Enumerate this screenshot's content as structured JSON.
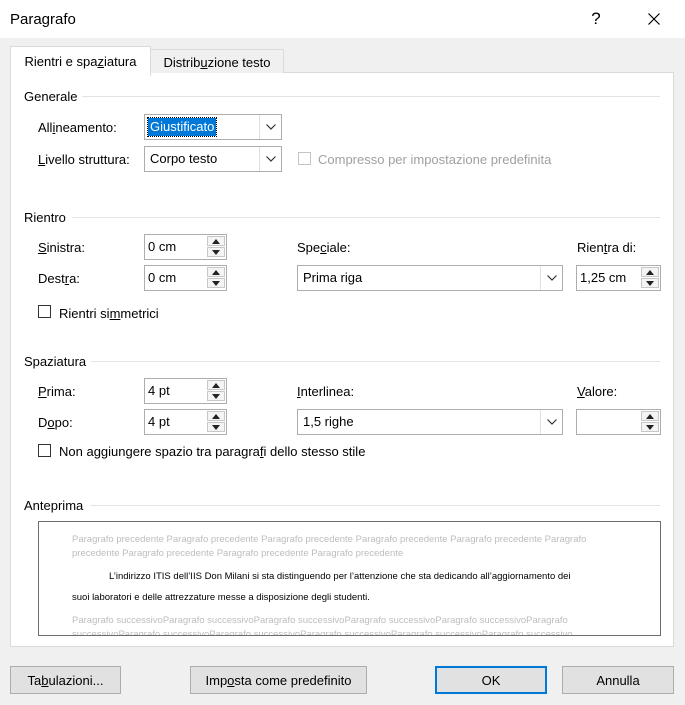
{
  "window": {
    "title": "Paragrafo",
    "help_label": "?",
    "close_label": "✕"
  },
  "tabs": [
    {
      "label": "Rientri e spaziatura",
      "active": true
    },
    {
      "label": "Distribuzione testo",
      "active": false
    }
  ],
  "general": {
    "title": "Generale",
    "alignment_label": "Allineamento:",
    "alignment_value": "Giustificato",
    "outline_label": "Livello struttura:",
    "outline_value": "Corpo testo",
    "collapsed_label": "Compresso per impostazione predefinita",
    "collapsed_checked": false
  },
  "indent": {
    "title": "Rientro",
    "left_label": "Sinistra:",
    "left_value": "0 cm",
    "right_label": "Destra:",
    "right_value": "0 cm",
    "special_label": "Speciale:",
    "special_value": "Prima riga",
    "by_label": "Rientra di:",
    "by_value": "1,25 cm",
    "mirror_label": "Rientri simmetrici",
    "mirror_checked": false
  },
  "spacing": {
    "title": "Spaziatura",
    "before_label": "Prima:",
    "before_value": "4 pt",
    "after_label": "Dopo:",
    "after_value": "4 pt",
    "line_label": "Interlinea:",
    "line_value": "1,5 righe",
    "at_label": "Valore:",
    "at_value": "",
    "no_space_label": "Non aggiungere spazio tra paragrafi dello stesso stile",
    "no_space_checked": false
  },
  "preview": {
    "title": "Anteprima",
    "prev_line1": "Paragrafo precedente Paragrafo precedente Paragrafo precedente Paragrafo precedente Paragrafo precedente Paragrafo",
    "prev_line2": "precedente Paragrafo precedente Paragrafo precedente Paragrafo precedente",
    "main_line1": "L’indirizzo ITIS dell’IIS Don Milani si sta distinguendo per l’attenzione che sta dedicando all’aggiornamento dei",
    "main_line2": "suoi laboratori e delle attrezzature messe a disposizione degli studenti.",
    "next_line1": "Paragrafo successivoParagrafo successivoParagrafo successivoParagrafo successivoParagrafo successivoParagrafo",
    "next_line2": "successivoParagrafo successivoParagrafo successivoParagrafo successivoParagrafo successivoParagrafo successivo"
  },
  "buttons": {
    "tabs_label": "Tabulazioni...",
    "default_label": "Imposta come predefinito",
    "ok_label": "OK",
    "cancel_label": "Annulla"
  },
  "colors": {
    "accent": "#0078d7",
    "dialog_bg": "#f0f0f0",
    "panel_bg": "#ffffff",
    "disabled_text": "#a0a0a0"
  }
}
